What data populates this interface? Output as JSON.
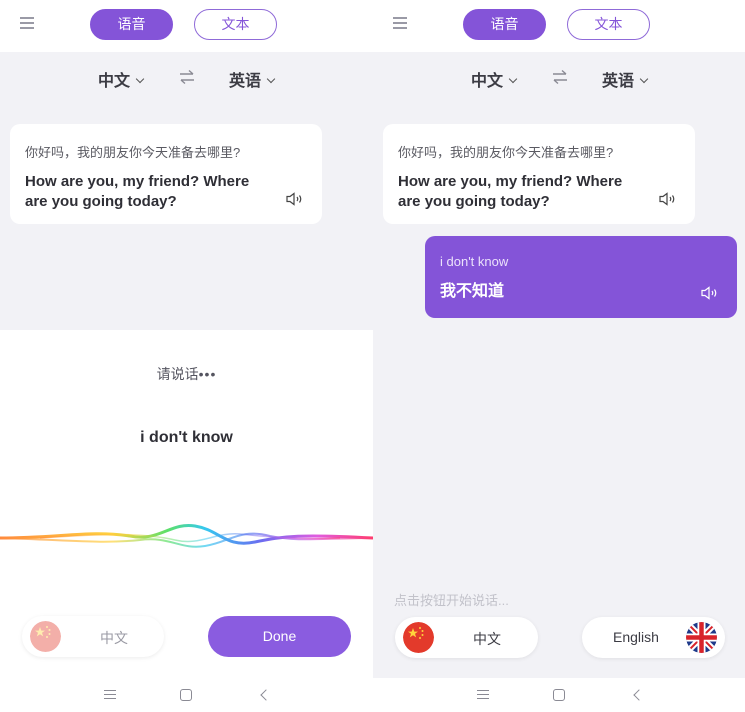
{
  "colors": {
    "accent": "#8454d8",
    "background": "#f2f2f6",
    "card": "#ffffff"
  },
  "left": {
    "tabs": {
      "voice": "语音",
      "text": "文本",
      "active": "voice"
    },
    "languages": {
      "source": "中文",
      "target": "英语"
    },
    "message": {
      "source": "你好吗，我的朋友你今天准备去哪里?",
      "translation": "How are you, my friend? Where are you going today?"
    },
    "listening": {
      "prompt": "请说话",
      "prompt_dots": "•••",
      "recognized": "i don't know"
    },
    "chip_cn": {
      "label": "中文",
      "flag_icon": "china-flag-icon"
    },
    "done_label": "Done"
  },
  "right": {
    "tabs": {
      "voice": "语音",
      "text": "文本",
      "active": "voice"
    },
    "languages": {
      "source": "中文",
      "target": "英语"
    },
    "messages": [
      {
        "source": "你好吗，我的朋友你今天准备去哪里?",
        "translation": "How are you, my friend? Where are you going today?"
      },
      {
        "source": "i don't know",
        "translation": "我不知道"
      }
    ],
    "hint": "点击按钮开始说话...",
    "chip_cn": {
      "label": "中文",
      "flag_icon": "china-flag-icon"
    },
    "chip_en": {
      "label": "English",
      "flag_icon": "uk-flag-icon"
    }
  }
}
